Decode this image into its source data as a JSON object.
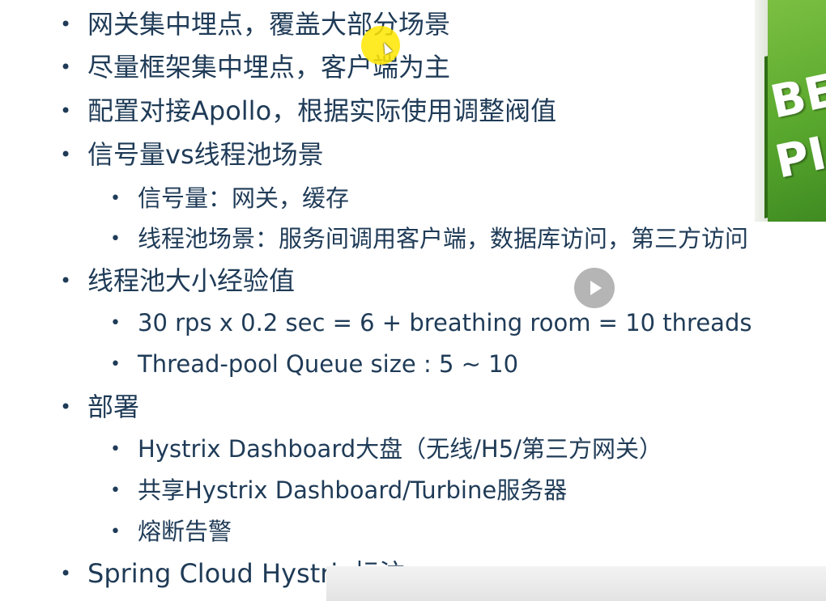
{
  "slide": {
    "items": [
      {
        "level": 1,
        "text": "网关集中埋点，覆盖大部分场景"
      },
      {
        "level": 1,
        "text": "尽量框架集中埋点，客户端为主"
      },
      {
        "level": 1,
        "text": "配置对接Apollo，根据实际使用调整阀值"
      },
      {
        "level": 1,
        "text": "信号量vs线程池场景"
      },
      {
        "level": 2,
        "text": "信号量：网关，缓存"
      },
      {
        "level": 2,
        "text": "线程池场景：服务间调用客户端，数据库访问，第三方访问"
      },
      {
        "level": 1,
        "text": "线程池大小经验值"
      },
      {
        "level": 2,
        "text": "30 rps x 0.2 sec = 6 + breathing room = 10 threads"
      },
      {
        "level": 2,
        "text": "Thread-pool Queue size : 5 ~ 10"
      },
      {
        "level": 1,
        "text": "部署"
      },
      {
        "level": 2,
        "text": "Hystrix Dashboard大盘（无线/H5/第三方网关）"
      },
      {
        "level": 2,
        "text": "共享Hystrix Dashboard/Turbine服务器"
      },
      {
        "level": 2,
        "text": "熔断告警"
      },
      {
        "level": 1,
        "text": "Spring Cloud Hystrix标注"
      }
    ],
    "bullet_char": "•"
  },
  "sign_image": {
    "line1": "BE",
    "line2": "PI"
  },
  "player": {
    "play_icon": "play-icon"
  },
  "colors": {
    "text": "#1f3b57",
    "sign_green": "#5aa92e",
    "highlight": "#ffe600"
  }
}
